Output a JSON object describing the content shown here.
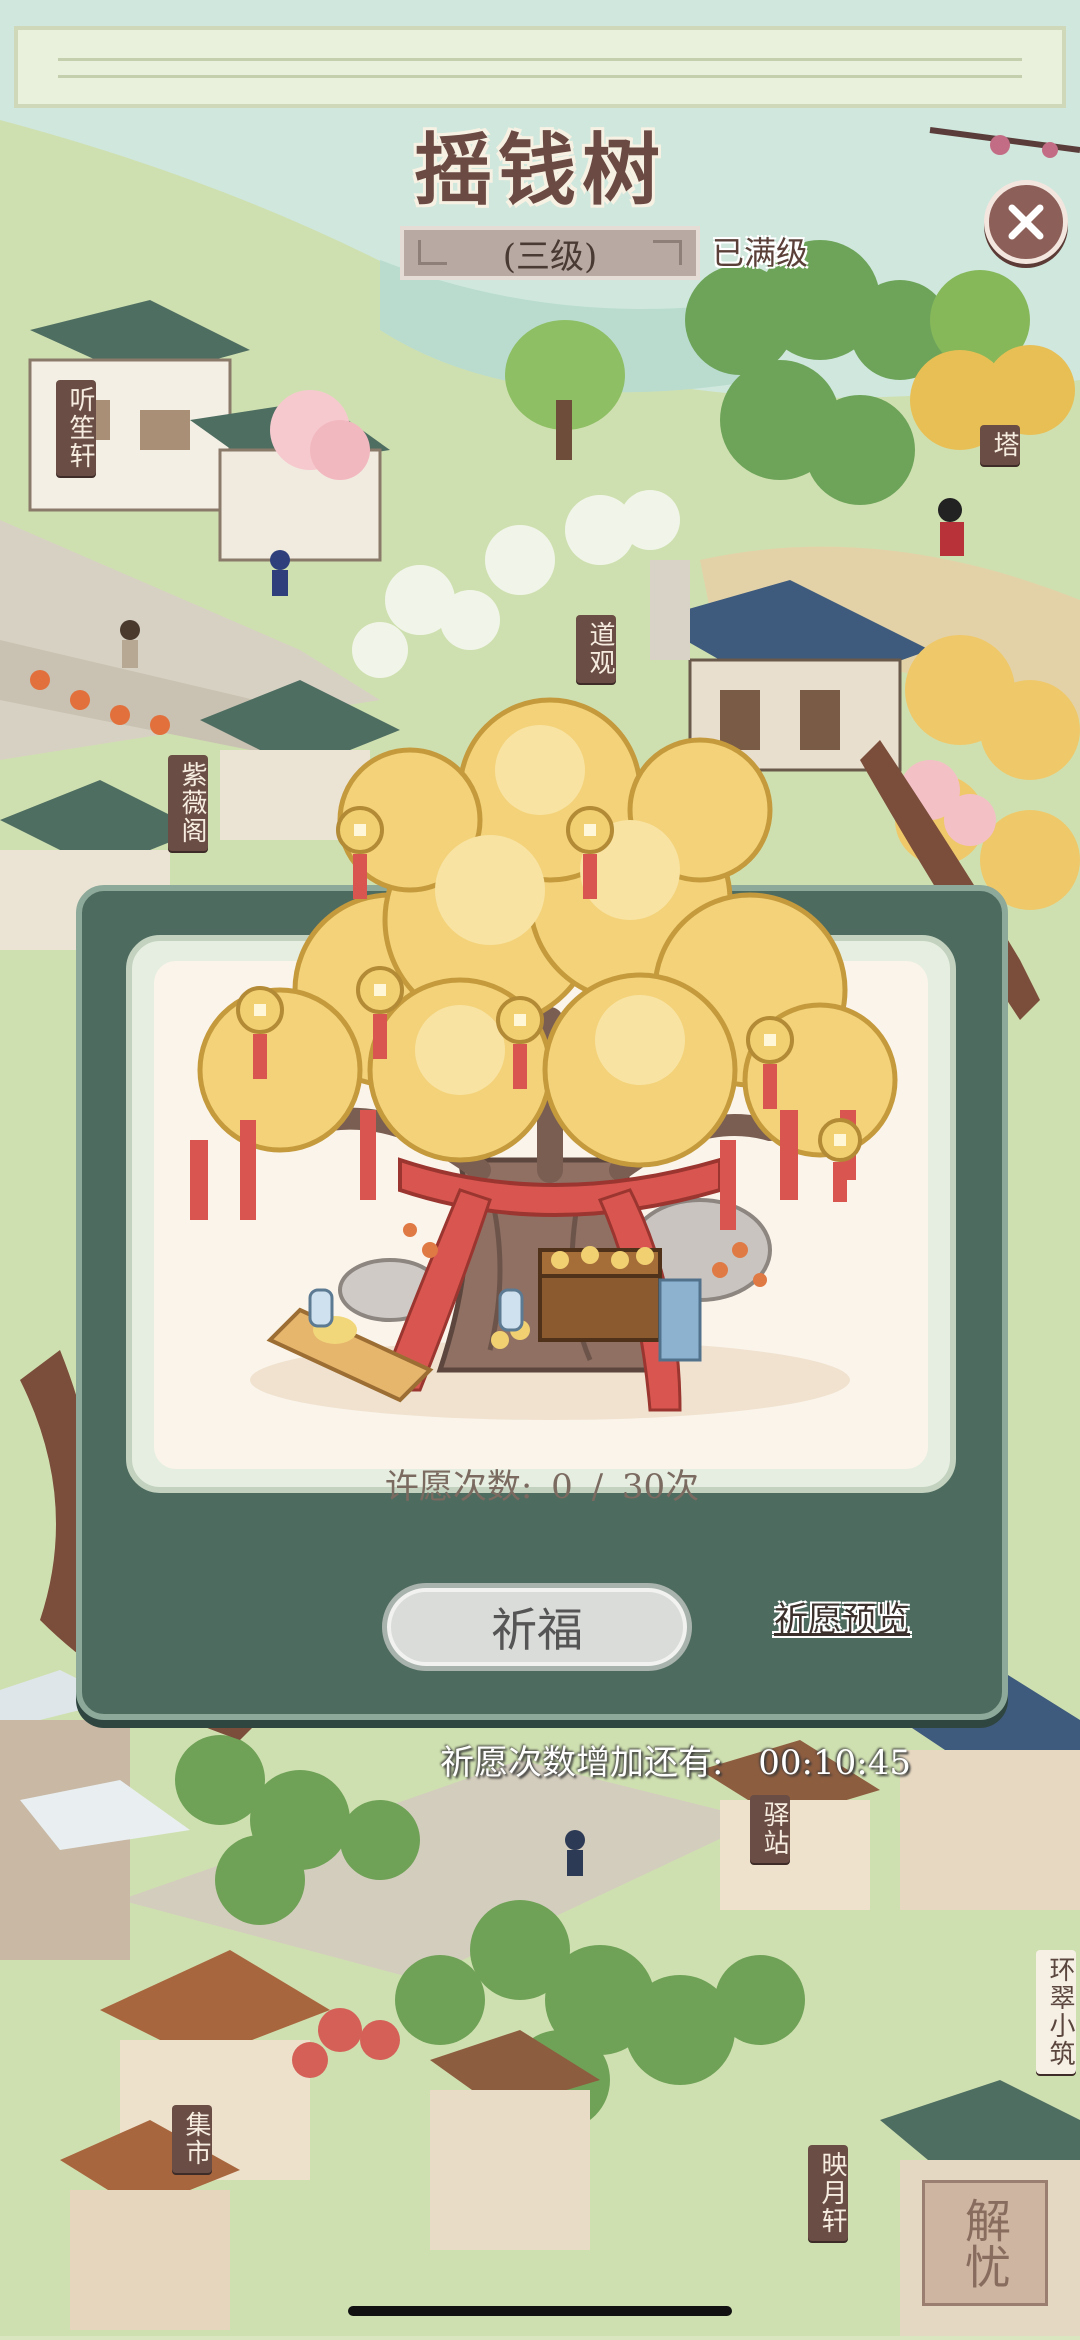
{
  "header": {
    "title": "摇钱树",
    "level": "(三级)",
    "max_level": "已满级"
  },
  "map_signs": {
    "tingsheng": "听笙轩",
    "ta": "塔",
    "daoguan": "道观",
    "ziwei": "紫薇阁",
    "yizhan": "驿站",
    "huancui": "环翠小筑",
    "jishi": "集市",
    "yingyue": "映月轩"
  },
  "card": {
    "wish_label": "许愿次数:",
    "wish_current": "0",
    "wish_sep": "/",
    "wish_total": "30次",
    "bless_button": "祈福",
    "preview_link": "祈愿预览"
  },
  "timer": {
    "label": "祈愿次数增加还有:",
    "value": "00:10:45"
  },
  "corner_seal": "解忧",
  "colors": {
    "card_border": "#4e6b60",
    "tree_gold": "#f3d27a",
    "ribbon_red": "#d8564f",
    "title_brown": "#6a4a43"
  },
  "icons": {
    "close": "close-icon"
  }
}
